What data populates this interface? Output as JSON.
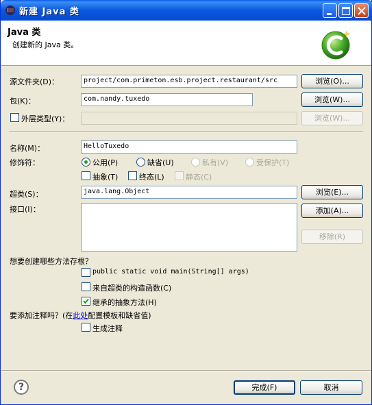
{
  "window": {
    "title": "新建 Java 类"
  },
  "header": {
    "title": "Java 类",
    "description": "创建新的 Java 类。"
  },
  "form": {
    "source_folder": {
      "label": "源文件夹(D)：",
      "value": "project/com.primeton.esb.project.restaurant/src",
      "button": "浏览(O)..."
    },
    "package": {
      "label": "包(K)：",
      "value": "com.nandy.tuxedo",
      "button": "浏览(W)..."
    },
    "enclosing_type": {
      "label": "外层类型(Y)：",
      "value": "",
      "button": "浏览(W)...",
      "checked": false
    },
    "name": {
      "label": "名称(M)：",
      "value": "HelloTuxedo"
    },
    "modifiers": {
      "label": "修饰符：",
      "public": "公用(P)",
      "default": "缺省(U)",
      "private": "私有(V)",
      "protected": "受保护(T)",
      "abstract": "抽象(T)",
      "final": "终态(L)",
      "static": "静态(C)"
    },
    "superclass": {
      "label": "超类(S)：",
      "value": "java.lang.Object",
      "button": "浏览(E)..."
    },
    "interfaces": {
      "label": "接口(I)：",
      "add_button": "添加(A)...",
      "remove_button": "移除(R)"
    }
  },
  "stubs": {
    "question": "想要创建哪些方法存根？",
    "main": "public static void main(String[] args)",
    "constructors": "来自超类的构造函数(C)",
    "inherited": "继承的抽象方法(H)"
  },
  "comments": {
    "question_prefix": "要添加注释吗？(在",
    "link": "此处",
    "question_suffix": "配置模板和缺省值)",
    "generate": "生成注释"
  },
  "footer": {
    "help": "?",
    "finish": "完成(F)",
    "cancel": "取消"
  }
}
